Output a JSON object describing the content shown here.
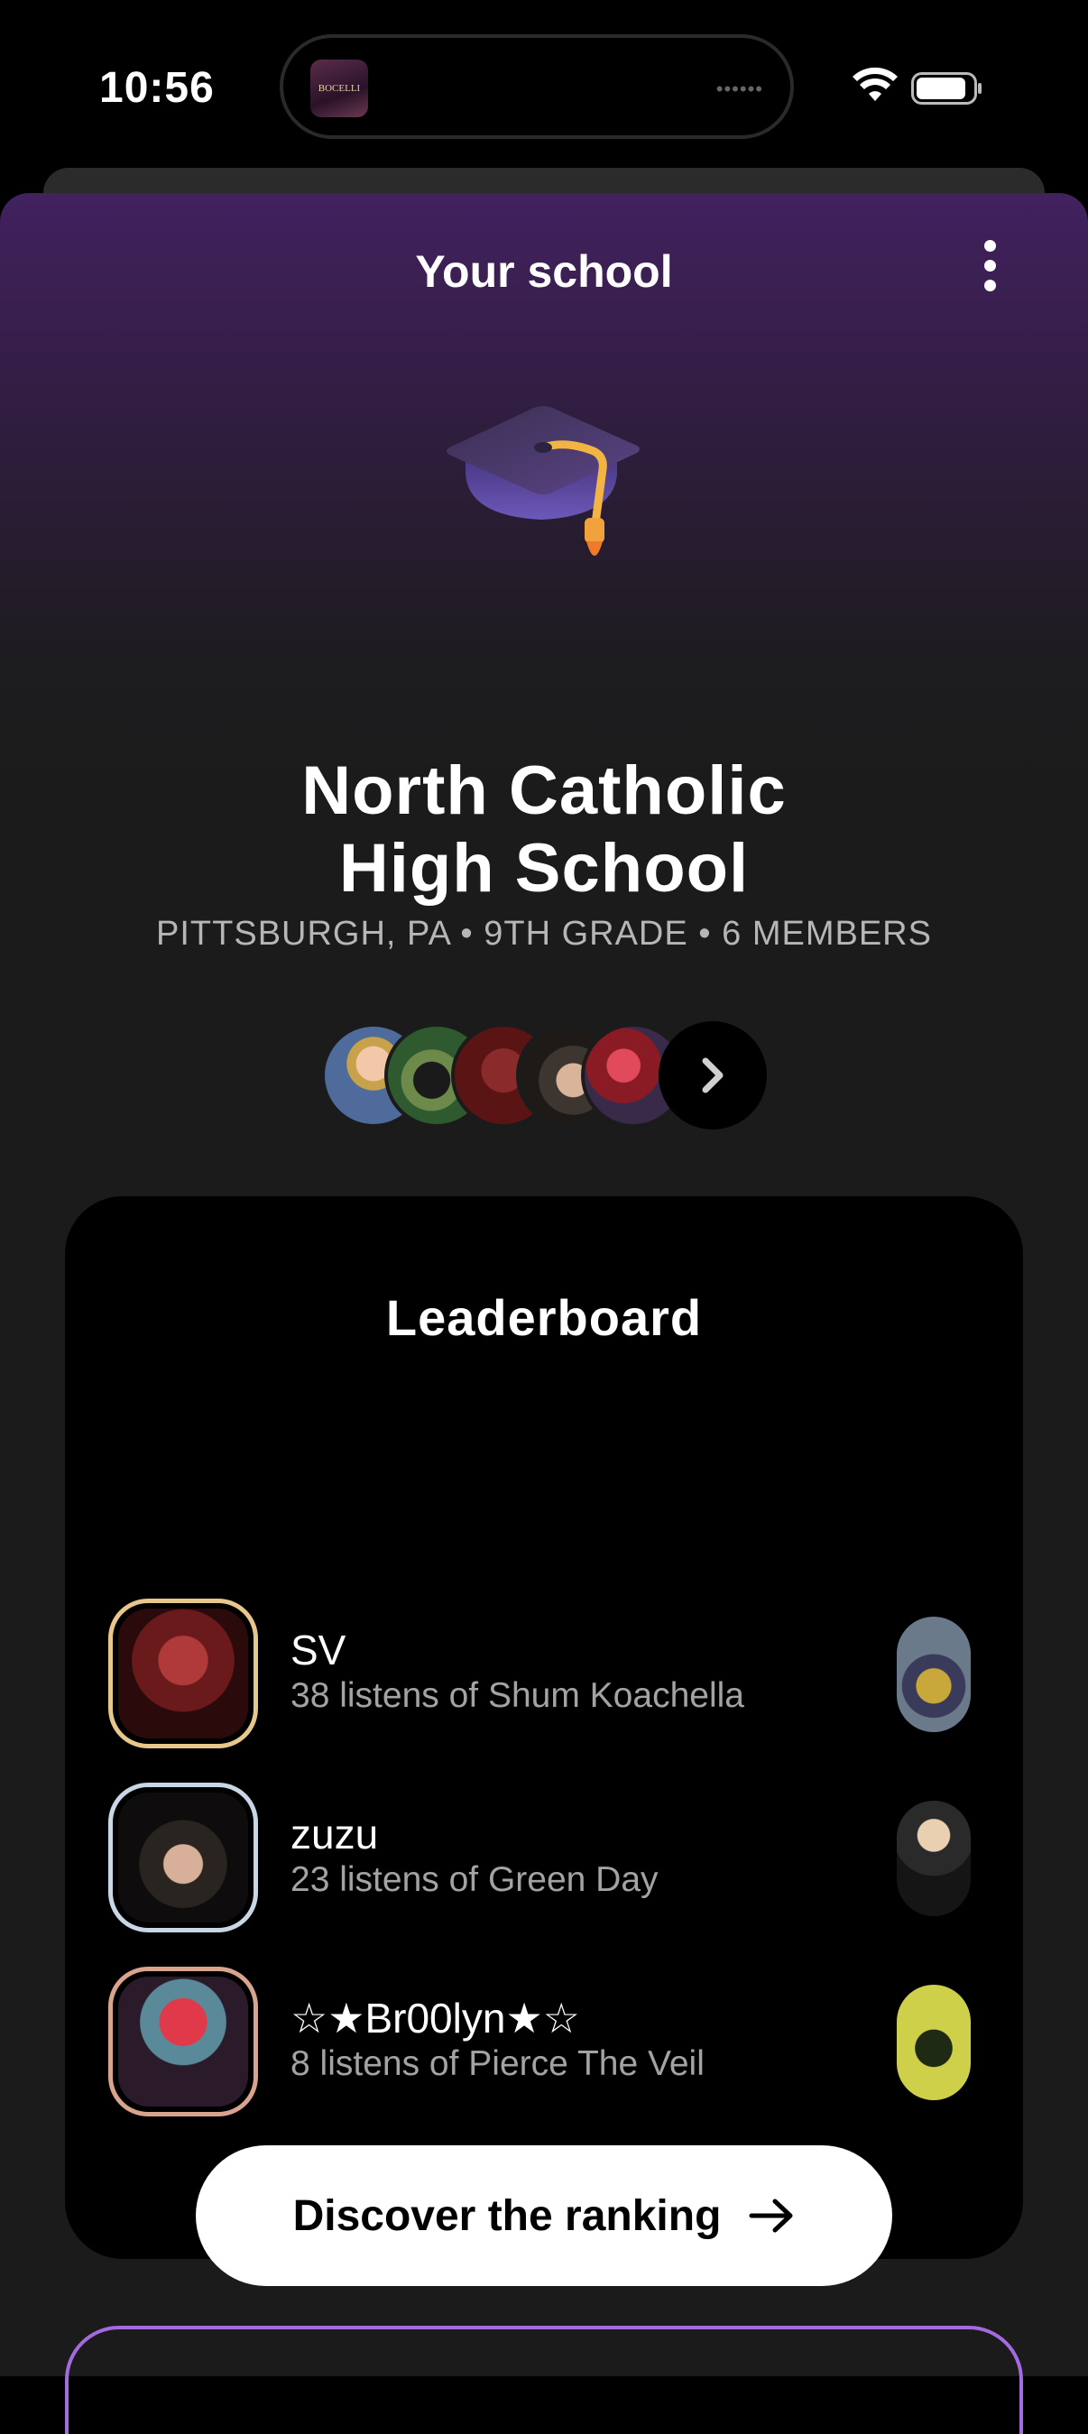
{
  "status_bar": {
    "time": "10:56",
    "island_art_text": "BOCELLI",
    "island_dots": "••••••"
  },
  "header": {
    "title": "Your school",
    "more_icon": "more-vertical-icon"
  },
  "school": {
    "name_line1": "North Catholic",
    "name_line2": "High School",
    "meta": "PITTSBURGH, PA • 9TH GRADE • 6 MEMBERS",
    "icon": "graduation-cap-icon"
  },
  "members": {
    "avatar_colors": [
      "#c7a24a",
      "#3b6a3a",
      "#6b1d1d",
      "#4a3b33",
      "#8a1b24"
    ],
    "next_icon": "chevron-right-icon"
  },
  "leaderboard": {
    "title": "Leaderboard",
    "rows": [
      {
        "name": "SV",
        "detail": "38 listens of Shum Koachella",
        "frame_color": "#e8c88a"
      },
      {
        "name": "zuzu",
        "detail": "23 listens of Green Day",
        "frame_color": "#c9d6e6"
      },
      {
        "name": "☆★Br00lyn★☆",
        "detail": "8 listens of Pierce The Veil",
        "frame_color": "#d9a48e"
      }
    ],
    "cta_label": "Discover the ranking",
    "cta_icon": "arrow-right-icon"
  },
  "colors": {
    "accent_purple": "#42215f",
    "next_card_border": "#a46ae0"
  }
}
